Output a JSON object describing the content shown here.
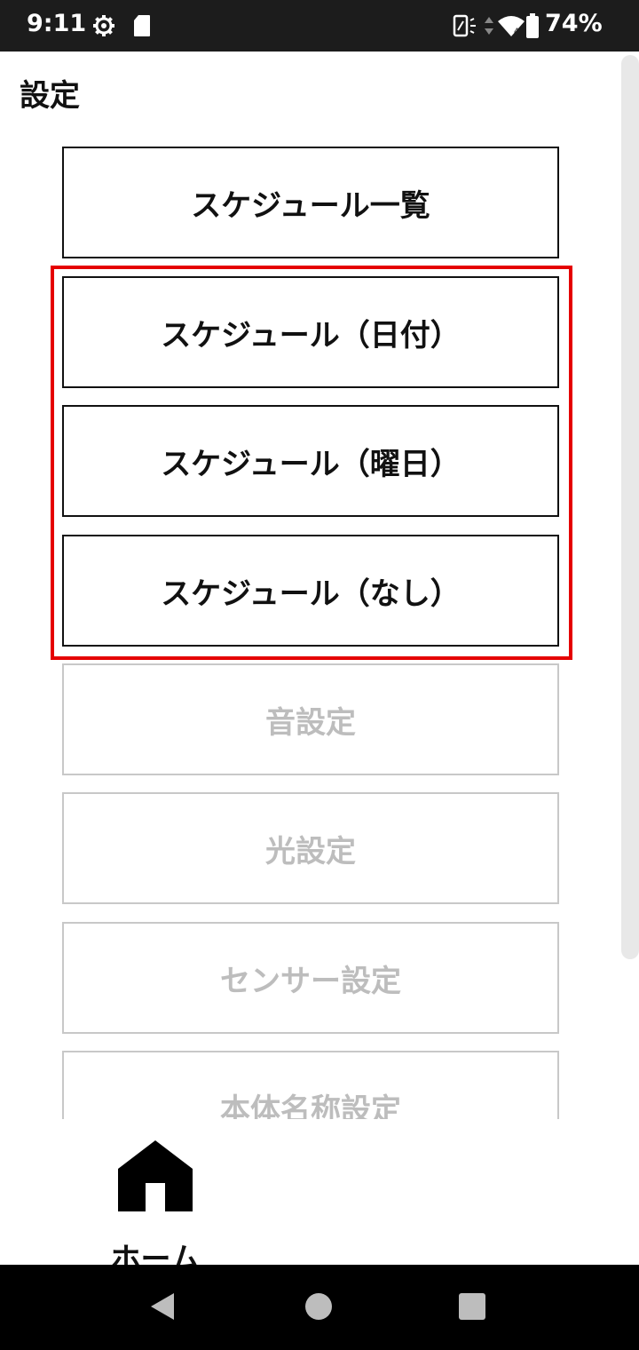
{
  "status_bar": {
    "time": "9:11",
    "battery": "74%"
  },
  "header": {
    "title": "設定"
  },
  "menu": {
    "items": [
      {
        "label": "スケジュール一覧",
        "enabled": true
      },
      {
        "label": "スケジュール（日付）",
        "enabled": true
      },
      {
        "label": "スケジュール（曜日）",
        "enabled": true
      },
      {
        "label": "スケジュール（なし）",
        "enabled": true
      },
      {
        "label": "音設定",
        "enabled": false
      },
      {
        "label": "光設定",
        "enabled": false
      },
      {
        "label": "センサー設定",
        "enabled": false
      },
      {
        "label": "本体名称設定",
        "enabled": false
      }
    ]
  },
  "bottom_nav": {
    "home_label": "ホーム"
  },
  "colors": {
    "highlight": "#e50000",
    "disabled_text": "#bdbdbd",
    "disabled_border": "#c8c8c8"
  }
}
